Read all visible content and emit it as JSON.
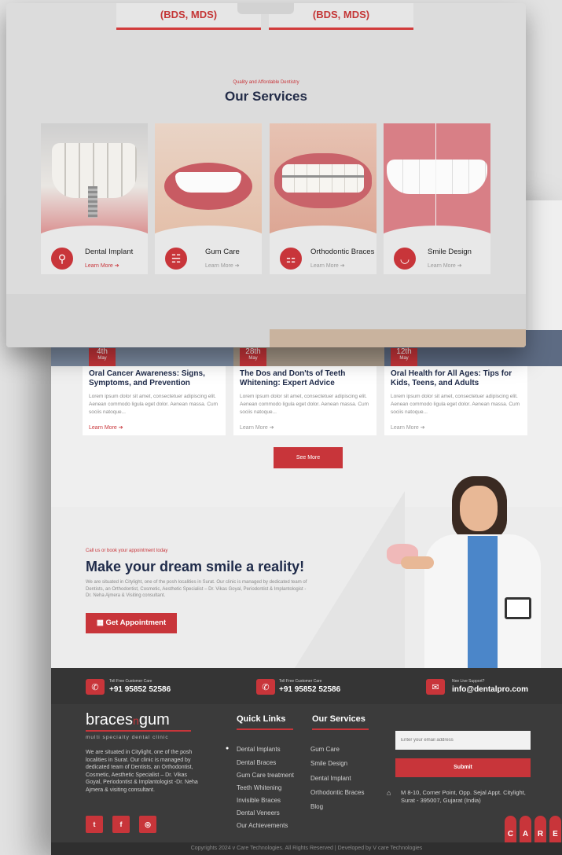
{
  "top_cards": [
    "(BDS, MDS)",
    "(BDS, MDS)"
  ],
  "services_section": {
    "kicker": "Quality and Affordable Dentistry",
    "title": "Our Services",
    "items": [
      {
        "name": "Dental Implant",
        "link": "Learn More"
      },
      {
        "name": "Gum Care",
        "link": "Learn More"
      },
      {
        "name": "Orthodontic Braces",
        "link": "Learn More"
      },
      {
        "name": "Smile Design",
        "link": "Learn More"
      }
    ]
  },
  "blog": {
    "posts": [
      {
        "day": "4th",
        "month": "May",
        "title": "Oral Cancer Awareness: Signs, Symptoms, and Prevention",
        "excerpt": "Lorem ipsum dolor sit amet, consectetuer adipiscing elit. Aenean commodo ligula eget dolor. Aenean massa. Cum sociis natoque...",
        "link": "Learn More"
      },
      {
        "day": "28th",
        "month": "May",
        "title": "The Dos and Don'ts of Teeth Whitening: Expert Advice",
        "excerpt": "Lorem ipsum dolor sit amet, consectetuer adipiscing elit. Aenean commodo ligula eget dolor. Aenean massa. Cum sociis natoque...",
        "link": "Learn More"
      },
      {
        "day": "12th",
        "month": "May",
        "title": "Oral Health for All Ages: Tips for Kids, Teens, and Adults",
        "excerpt": "Lorem ipsum dolor sit amet, consectetuer adipiscing elit. Aenean commodo ligula eget dolor. Aenean massa. Cum sociis natoque...",
        "link": "Learn More"
      }
    ],
    "see_more": "See More"
  },
  "cta": {
    "kicker": "Call us or book your appointment today",
    "title": "Make your dream smile a reality!",
    "text": "We are situated in Citylight, one of the posh localities in Surat. Our clinic is managed by dedicated team of Dentists, an Orthodontist, Cosmetic, Aesthetic Specialist – Dr. Vikas Goyal, Periodontist & Implantologist -Dr. Neha Ajmera & Visiting consultant.",
    "button": "Get Appointment"
  },
  "contact_bar": [
    {
      "label": "Toll Free Customer Care",
      "value": "+91 95852 52586"
    },
    {
      "label": "Toll Free Customer Care",
      "value": "+91 95852 52586"
    },
    {
      "label": "Nee Live Support?",
      "value": "info@dentalpro.com"
    }
  ],
  "footer": {
    "logo_main": "braces",
    "logo_mid": "n",
    "logo_end": "gum",
    "logo_tag": "multi specialty dental clinic",
    "about": "We are situated in Citylight, one of the posh localities in Surat. Our clinic is managed by dedicated team of Dentists, an Orthodontist, Cosmetic, Aesthetic Specialist – Dr. Vikas Goyal, Periodontist & Implantologist -Dr. Neha Ajmera & visiting consultant.",
    "social": [
      "twitter-icon",
      "facebook-icon",
      "instagram-icon"
    ],
    "quick_links_title": "Quick Links",
    "quick_links": [
      "Dental Implants",
      "Dental Braces",
      "Gum Care treatment",
      "Teeth Whitening",
      "Invisible Braces",
      "Dental Veneers",
      "Our Achievements"
    ],
    "services_title": "Our Services",
    "services": [
      "Gum Care",
      "Smile Design",
      "Dental Implant",
      "Orthodontic Braces",
      "Blog"
    ],
    "email_placeholder": "Enter your email address",
    "submit": "Submit",
    "address": "M 8-10, Corner Point, Opp. Sejal Appt. Citylight, Surat - 395007, Gujarat (India)",
    "care_letters": [
      "C",
      "A",
      "R",
      "E"
    ],
    "copyright": "Copyrights 2024 v Care  Technologies. All Rights Reserved | Developed  by V care Technologies"
  },
  "colors": {
    "accent": "#c8353a",
    "navy": "#1f2b4a",
    "footer": "#3b3b3b"
  }
}
